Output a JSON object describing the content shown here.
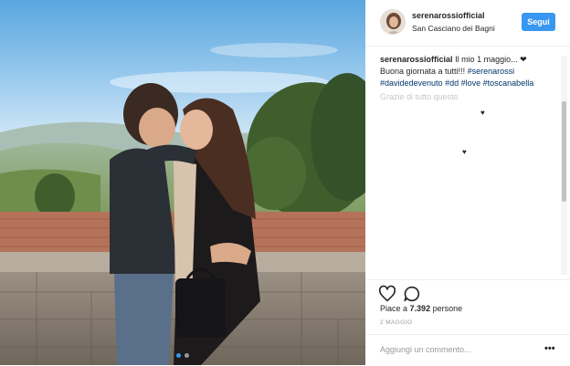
{
  "header": {
    "username": "serenarossiofficial",
    "location": "San Casciano dei Bagni",
    "follow_label": "Segui"
  },
  "caption": {
    "username": "serenarossiofficial",
    "text": "Il mio 1 maggio... ❤",
    "line2": "Buona giornata a tutti!!!",
    "hashtags": [
      "#serenarossi",
      "#davidedevenuto",
      "#dd",
      "#love",
      "#toscanabella"
    ],
    "faded_text": "Grazie di tutto questo"
  },
  "likes": {
    "prefix": "Piace a",
    "count": "7.392",
    "suffix": "persone"
  },
  "date": "2 MAGGIO",
  "comment_box": {
    "placeholder": "Aggiungi un commento..."
  },
  "more_label": "•••",
  "carousel": {
    "slides": 2,
    "active": 1
  },
  "icons": {
    "like": "heart-icon",
    "comment": "comment-icon",
    "more": "more-options-icon"
  },
  "colors": {
    "accent": "#3897f0",
    "hashtag": "#003569",
    "muted": "#999999"
  }
}
